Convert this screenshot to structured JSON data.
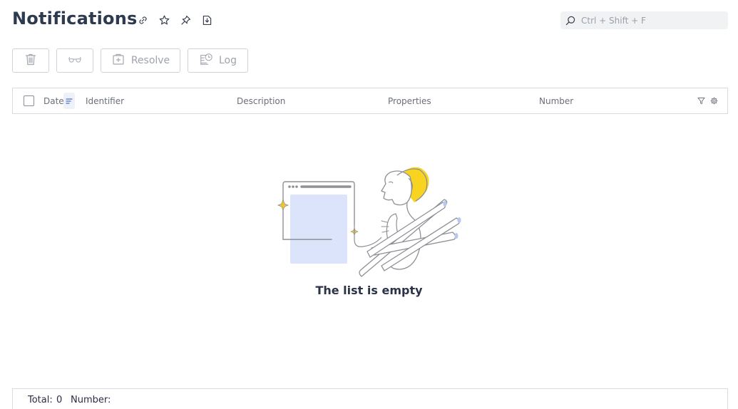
{
  "header": {
    "title": "Notifications",
    "icons": [
      "link-icon",
      "star-icon",
      "pin-icon",
      "export-icon"
    ]
  },
  "search": {
    "placeholder": "Ctrl + Shift + F",
    "value": ""
  },
  "toolbar": {
    "delete_icon": "trash-icon",
    "view_icon": "glasses-icon",
    "resolve_label": "Resolve",
    "log_label": "Log"
  },
  "table": {
    "columns": [
      "Date",
      "Identifier",
      "Description",
      "Properties",
      "Number"
    ],
    "sort_icon": "sort-descending-icon",
    "filter_icon": "filter-icon",
    "settings_icon": "gear-icon"
  },
  "empty_state": {
    "message": "The list is empty"
  },
  "footer": {
    "total_label": "Total:",
    "total_value": "0",
    "number_label": "Number:"
  },
  "colors": {
    "title": "#2e3a50",
    "accent_yellow": "#f8d320",
    "illustration_blue": "#dbe4fb",
    "border": "#d8dbe0"
  }
}
